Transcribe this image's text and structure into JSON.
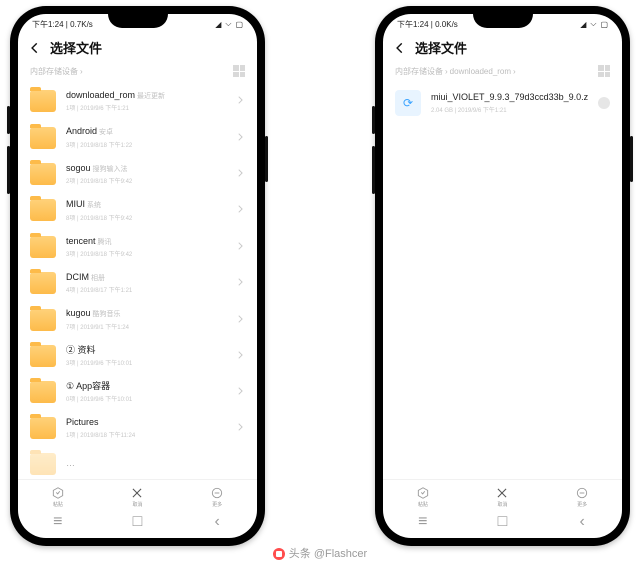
{
  "watermark": "头条 @Flashcer",
  "statusbar": {
    "time": "下午1:24",
    "net": "0.7K/s",
    "net2": "0.0K/s"
  },
  "header": {
    "title": "选择文件"
  },
  "breadcrumb_left": {
    "root": "内部存储设备",
    "sep": "›"
  },
  "breadcrumb_right": {
    "root": "内部存储设备",
    "sep": "›",
    "child": "downloaded_rom"
  },
  "folders": [
    {
      "name": "downloaded_rom",
      "sub": "最近更新",
      "meta": "1项 | 2019/9/6 下午1:21"
    },
    {
      "name": "Android",
      "sub": "安卓",
      "meta": "3项 | 2019/8/18 下午1:22"
    },
    {
      "name": "sogou",
      "sub": "搜狗输入法",
      "meta": "2项 | 2019/8/18 下午9:42"
    },
    {
      "name": "MIUI",
      "sub": "系统",
      "meta": "8项 | 2019/8/18 下午9:42"
    },
    {
      "name": "tencent",
      "sub": "腾讯",
      "meta": "3项 | 2019/8/18 下午9:42"
    },
    {
      "name": "DCIM",
      "sub": "相册",
      "meta": "4项 | 2019/8/17 下午1:21"
    },
    {
      "name": "kugou",
      "sub": "酷狗音乐",
      "meta": "7项 | 2019/9/1 下午1:24"
    },
    {
      "name": "② 资料",
      "sub": "",
      "meta": "3项 | 2019/9/6 下午10:01"
    },
    {
      "name": "① App容器",
      "sub": "",
      "meta": "0项 | 2019/9/6 下午10:01"
    },
    {
      "name": "Pictures",
      "sub": "",
      "meta": "1项 | 2019/8/18 下午11:24"
    }
  ],
  "file": {
    "name": "miui_VIOLET_9.9.3_79d3ccd33b_9.0.zip",
    "meta": "2.04 GB | 2019/9/6 下午1:21"
  },
  "bottombar": {
    "b0": "粘贴",
    "b1": "取消",
    "b2": "更多"
  },
  "nav": {
    "menu": "≡",
    "home": "□",
    "back": "‹"
  }
}
